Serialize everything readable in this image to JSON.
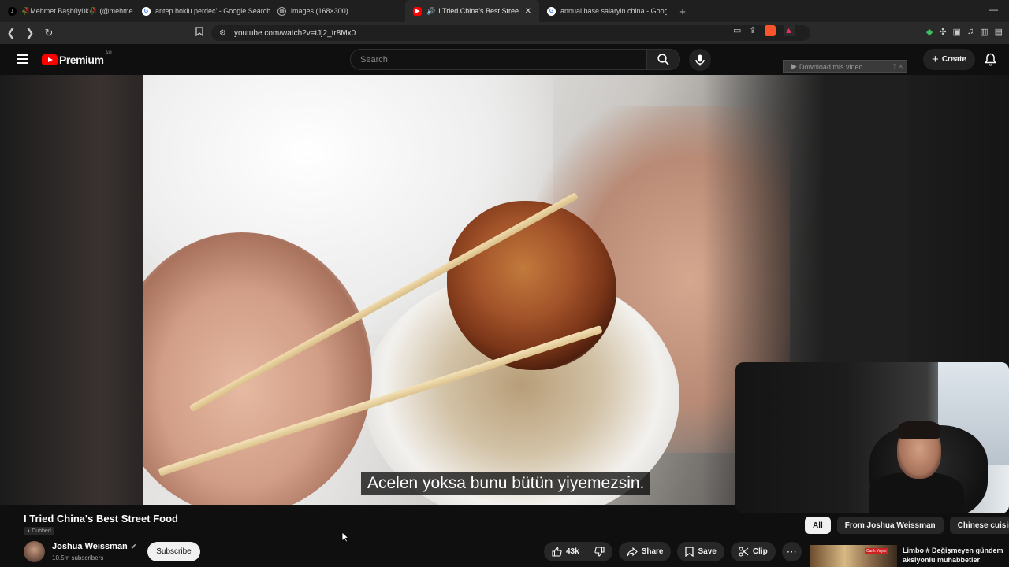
{
  "browser": {
    "tabs": [
      {
        "label": "🥀Mehmet Başbüyük🥀 (@mehme",
        "icon": "tiktok-icon",
        "active": false
      },
      {
        "label": "antep boklu perdec' - Google Search",
        "icon": "google-icon",
        "active": false
      },
      {
        "label": "images (168×300)",
        "icon": "globe-icon",
        "active": false
      },
      {
        "label": "I Tried China's Best Street Foo",
        "icon": "youtube-icon",
        "active": true
      },
      {
        "label": "annual base salaryin china - Google",
        "icon": "google-icon",
        "active": false
      }
    ],
    "url": "youtube.com/watch?v=tJj2_tr8Mx0"
  },
  "header": {
    "logo_text": "Premium",
    "country_code": "AU",
    "search_placeholder": "Search",
    "download_banner": "Download this video",
    "download_help": "?",
    "create_label": "Create"
  },
  "video": {
    "subtitle": "Acelen yoksa bunu bütün yiyemezsin.",
    "title": "I Tried China's Best Street Food",
    "dubbed_label": "Dubbed"
  },
  "channel": {
    "name": "Joshua Weissman",
    "subscribers": "10.5m subscribers",
    "subscribe_label": "Subscribe"
  },
  "actions": {
    "like_count": "43k",
    "share_label": "Share",
    "save_label": "Save",
    "clip_label": "Clip"
  },
  "chips": [
    "All",
    "From Joshua Weissman",
    "Chinese cuisine"
  ],
  "recommendation": {
    "title_line1": "Limbo # Değişmeyen gündem",
    "title_line2": "aksiyonlu muhabbetler",
    "badge": "Canlı Yayın"
  },
  "colors": {
    "youtube_red": "#ff0000",
    "background": "#0f0f0f",
    "chip_bg": "#272727"
  }
}
